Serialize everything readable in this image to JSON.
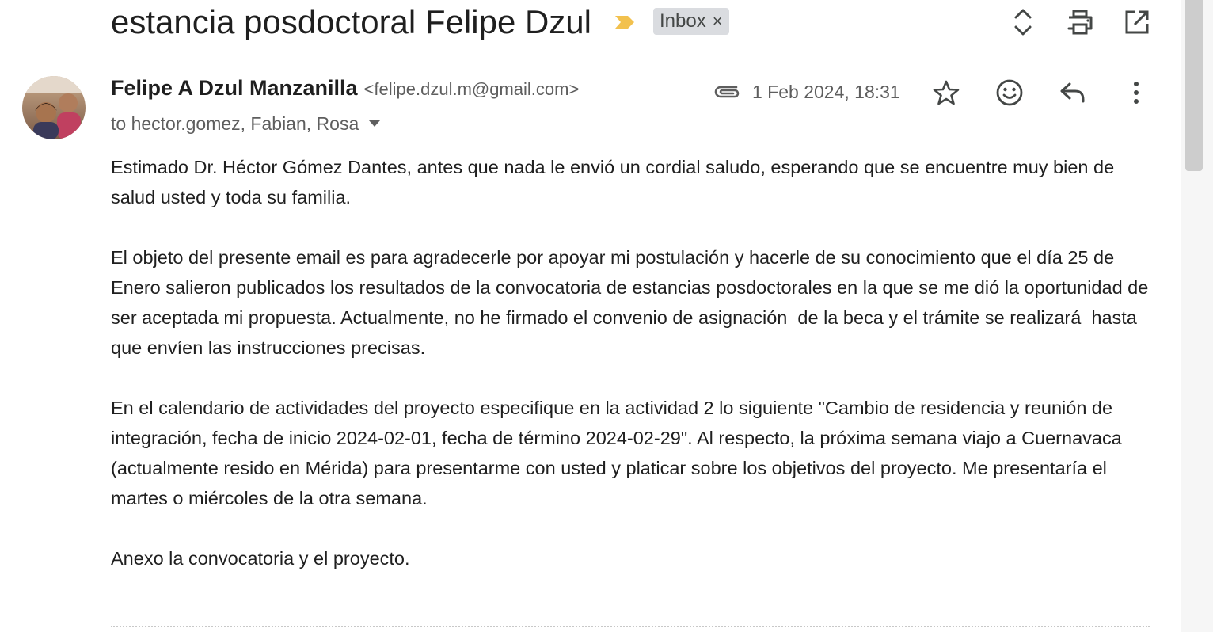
{
  "subject": "estancia posdoctoral Felipe Dzul",
  "label": {
    "name": "Inbox",
    "remove": "×"
  },
  "top_actions": [
    "expand-collapse-icon",
    "print-icon",
    "open-in-new-window-icon"
  ],
  "sender": {
    "name": "Felipe A Dzul Manzanilla",
    "email": "<felipe.dzul.m@gmail.com>"
  },
  "recipients": "to hector.gomez, Fabian, Rosa",
  "date": "1 Feb 2024, 18:31",
  "message_actions": [
    "star-icon",
    "emoji-reaction-icon",
    "reply-icon",
    "more-options-icon"
  ],
  "body": {
    "paragraphs": [
      "Estimado Dr. Héctor Gómez Dantes, antes que nada le envió un cordial saludo, esperando que se encuentre muy bien de salud usted y toda su familia.",
      "El objeto del presente email es para agradecerle por apoyar mi postulación y hacerle de su conocimiento que el día 25 de Enero salieron publicados los resultados de la convocatoria de estancias posdoctorales en la que se me dió la oportunidad de ser aceptada mi propuesta. Actualmente, no he firmado el convenio de asignación  de la beca y el trámite se realizará  hasta que envíen las instrucciones precisas.",
      "En el calendario de actividades del proyecto especifique en la actividad 2 lo siguiente \"Cambio de residencia y reunión de integración, fecha de inicio 2024-02-01, fecha de término 2024-02-29\". Al respecto, la próxima semana viajo a Cuernavaca (actualmente resido en Mérida) para presentarme con usted y platicar sobre los objetivos del proyecto. Me presentaría el martes o miércoles de la otra semana.",
      "Anexo la convocatoria y el proyecto."
    ]
  },
  "colors": {
    "importance_marker": "#f2c14e",
    "chip_bg": "#dadce0",
    "text_primary": "#1f1f1f",
    "text_secondary": "#5e5e5e"
  }
}
